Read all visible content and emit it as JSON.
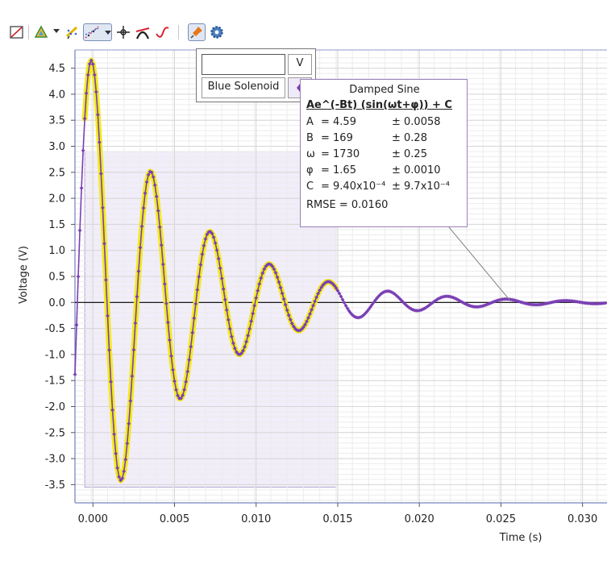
{
  "toolbar": {
    "buttons": [
      {
        "icon": "table-chart-icon",
        "active": false
      },
      {
        "icon": "analyze-triangle-icon",
        "active": false,
        "dropdown": true
      },
      {
        "icon": "draw-prediction-icon",
        "active": false
      },
      {
        "icon": "curve-fit-icon",
        "active": true,
        "dropdown": true
      },
      {
        "icon": "examine-crosshair-icon",
        "active": false
      },
      {
        "icon": "tangent-icon",
        "active": false
      },
      {
        "icon": "integral-icon",
        "active": false
      },
      {
        "icon": "annotation-pin-icon",
        "active": true
      },
      {
        "icon": "settings-gear-icon",
        "active": false
      }
    ]
  },
  "legend": {
    "unit_input_value": "",
    "unit_label": "V",
    "series_name": "Blue Solenoid"
  },
  "fit": {
    "title": "Damped Sine",
    "equation": "Ae^(-Bt) (sin(ωt+φ)) + C",
    "params": [
      {
        "name": "A",
        "value": "= 4.59",
        "uncertainty": "± 0.0058"
      },
      {
        "name": "B",
        "value": "= 169",
        "uncertainty": "± 0.28"
      },
      {
        "name": "ω",
        "value": "= 1730",
        "uncertainty": "± 0.25"
      },
      {
        "name": "φ",
        "value": "= 1.65",
        "uncertainty": "± 0.0010"
      },
      {
        "name": "C",
        "value": "= 9.40x10⁻⁴",
        "uncertainty": "± 9.7x10⁻⁴"
      }
    ],
    "rmse": "RMSE = 0.0160"
  },
  "chart_data": {
    "type": "scatter",
    "xlabel": "Time (s)",
    "ylabel": "Voltage (V)",
    "xlim": [
      -0.0011,
      0.0315
    ],
    "ylim": [
      -3.85,
      4.85
    ],
    "xticks": [
      0.0,
      0.005,
      0.01,
      0.015,
      0.02,
      0.025,
      0.03
    ],
    "xtick_labels": [
      "0.000",
      "0.005",
      "0.010",
      "0.015",
      "0.020",
      "0.025",
      "0.030"
    ],
    "yticks": [
      -3.5,
      -3.0,
      -2.5,
      -2.0,
      -1.5,
      -1.0,
      -0.5,
      0.0,
      0.5,
      1.0,
      1.5,
      2.0,
      2.5,
      3.0,
      3.5,
      4.0,
      4.5
    ],
    "ytick_labels": [
      "-3.5",
      "-3.0",
      "-2.5",
      "-2.0",
      "-1.5",
      "-1.0",
      "-0.5",
      "0.0",
      "0.5",
      "1.0",
      "1.5",
      "2.0",
      "2.5",
      "3.0",
      "3.5",
      "4.0",
      "4.5"
    ],
    "grid": true,
    "selected_region": {
      "x": [
        -0.0005,
        0.0149
      ],
      "y": [
        -3.55,
        2.9
      ]
    },
    "series": [
      {
        "name": "Blue Solenoid",
        "color": "#7a3fb4",
        "marker": "diamond",
        "model": {
          "A": 4.59,
          "B": 169,
          "omega": 1730,
          "phi": 1.65,
          "C": 0.00094
        },
        "x_start": -0.0011,
        "x_end": 0.0315,
        "x_step": 0.0001
      }
    ],
    "fit_curve": {
      "color": "#f2ea1c",
      "x_range": [
        -0.0005,
        0.0149
      ]
    },
    "colors": {
      "series": "#7a3fb4",
      "fit": "#f2ea1c",
      "region": "#f1edf9",
      "region_border": "#b4a6d2",
      "grid": "#d6d6d6",
      "minor_grid": "#ececec",
      "axis": "#8e98c8"
    }
  }
}
